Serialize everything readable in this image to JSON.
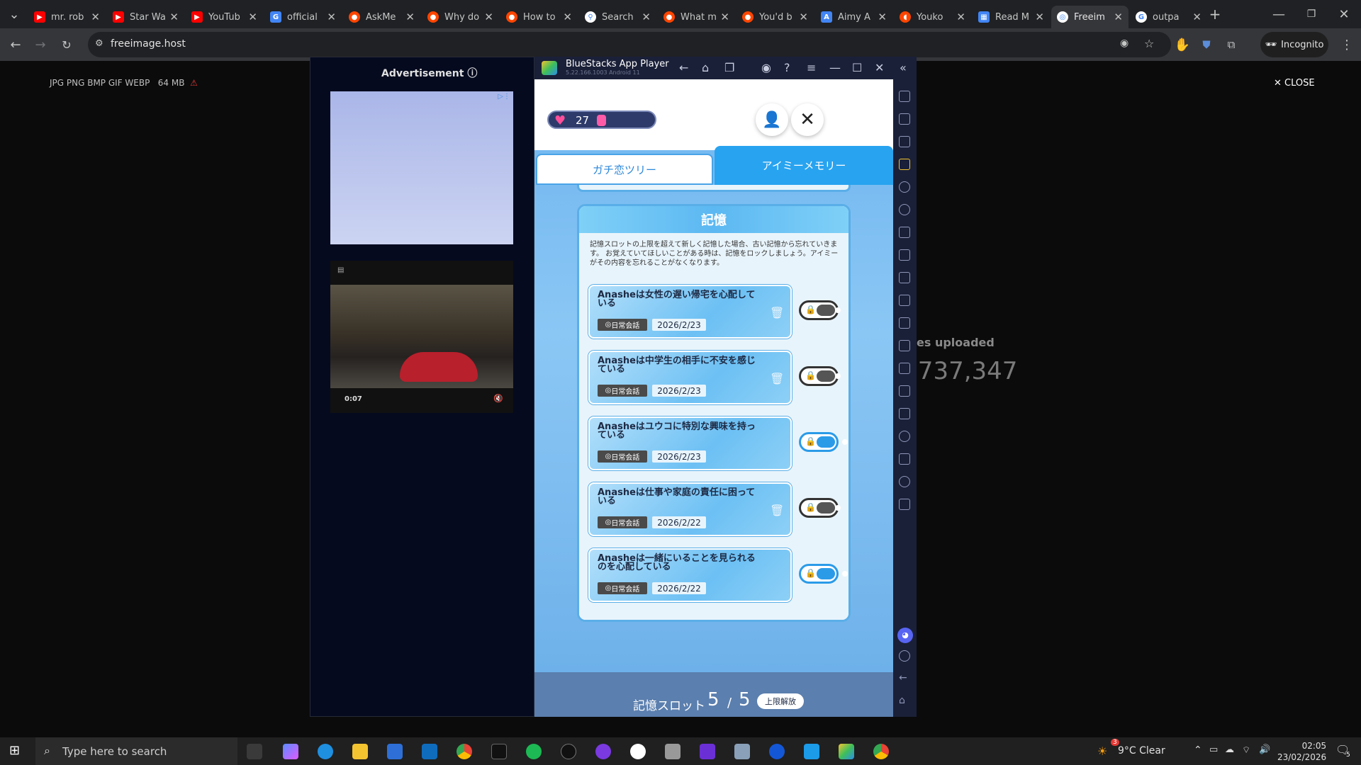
{
  "browser": {
    "tabs": [
      {
        "title": "mr. rob",
        "icon": "youtube-icon"
      },
      {
        "title": "Star Wa",
        "icon": "youtube-icon"
      },
      {
        "title": "YouTub",
        "icon": "youtube-icon"
      },
      {
        "title": "official",
        "icon": "google-docs-icon"
      },
      {
        "title": "AskMe",
        "icon": "reddit-icon"
      },
      {
        "title": "Why do",
        "icon": "reddit-icon"
      },
      {
        "title": "How to",
        "icon": "reddit-icon"
      },
      {
        "title": "Search",
        "icon": "search-icon"
      },
      {
        "title": "What m",
        "icon": "reddit-icon"
      },
      {
        "title": "You'd b",
        "icon": "reddit-icon"
      },
      {
        "title": "Aimy A",
        "icon": "aimy-icon"
      },
      {
        "title": "Youko",
        "icon": "youkoso-icon"
      },
      {
        "title": "Read M",
        "icon": "read-icon"
      },
      {
        "title": "Freeim",
        "icon": "freeimage-icon",
        "active": true
      },
      {
        "title": "outpa",
        "icon": "google-icon"
      }
    ],
    "url": "freeimage.host",
    "incognito_label": "Incognito"
  },
  "page": {
    "formats": "JPG PNG BMP GIF WEBP",
    "max_size": "64 MB",
    "close_label": "CLOSE",
    "uploaded_label": "es uploaded",
    "uploaded_count": ",737,347"
  },
  "ad": {
    "title": "Advertisement",
    "video_time": "0:07"
  },
  "bluestacks": {
    "title": "BlueStacks App Player",
    "version": "5.22.166.1003  Android 11"
  },
  "game": {
    "hearts": "27",
    "heart_fill_pct": 8,
    "tabs": [
      "ガチ恋ツリー",
      "アイミーメモリー"
    ],
    "active_tab": 1,
    "card_title": "記憶",
    "description": "記憶スロットの上限を超えて新しく記憶した場合、古い記憶から忘れていきます。 お覚えていてほしいことがある時は、記憶をロックしましょう。アイミーがその内容を忘れることがなくなります。",
    "memories": [
      {
        "text": "Anasheは女性の遅い帰宅を心配している",
        "tag": "日常会話",
        "date": "2026/2/23",
        "locked": false,
        "deletable": true
      },
      {
        "text": "Anasheは中学生の相手に不安を感じている",
        "tag": "日常会話",
        "date": "2026/2/23",
        "locked": false,
        "deletable": true
      },
      {
        "text": "Anasheはユウコに特別な興味を持っている",
        "tag": "日常会話",
        "date": "2026/2/23",
        "locked": true,
        "deletable": false
      },
      {
        "text": "Anasheは仕事や家庭の責任に困っている",
        "tag": "日常会話",
        "date": "2026/2/22",
        "locked": false,
        "deletable": true
      },
      {
        "text": "Anasheは一緒にいることを見られるのを心配している",
        "tag": "日常会話",
        "date": "2026/2/22",
        "locked": true,
        "deletable": false
      }
    ],
    "slot_label": "記憶スロット",
    "slot_used": "5",
    "slot_sep": "/",
    "slot_max": "5",
    "unlock_label": "上限解放"
  },
  "taskbar": {
    "search_placeholder": "Type here to search",
    "weather": "9°C  Clear",
    "weather_badge": "3",
    "time": "02:05",
    "date": "23/02/2026",
    "notifications": "5"
  }
}
